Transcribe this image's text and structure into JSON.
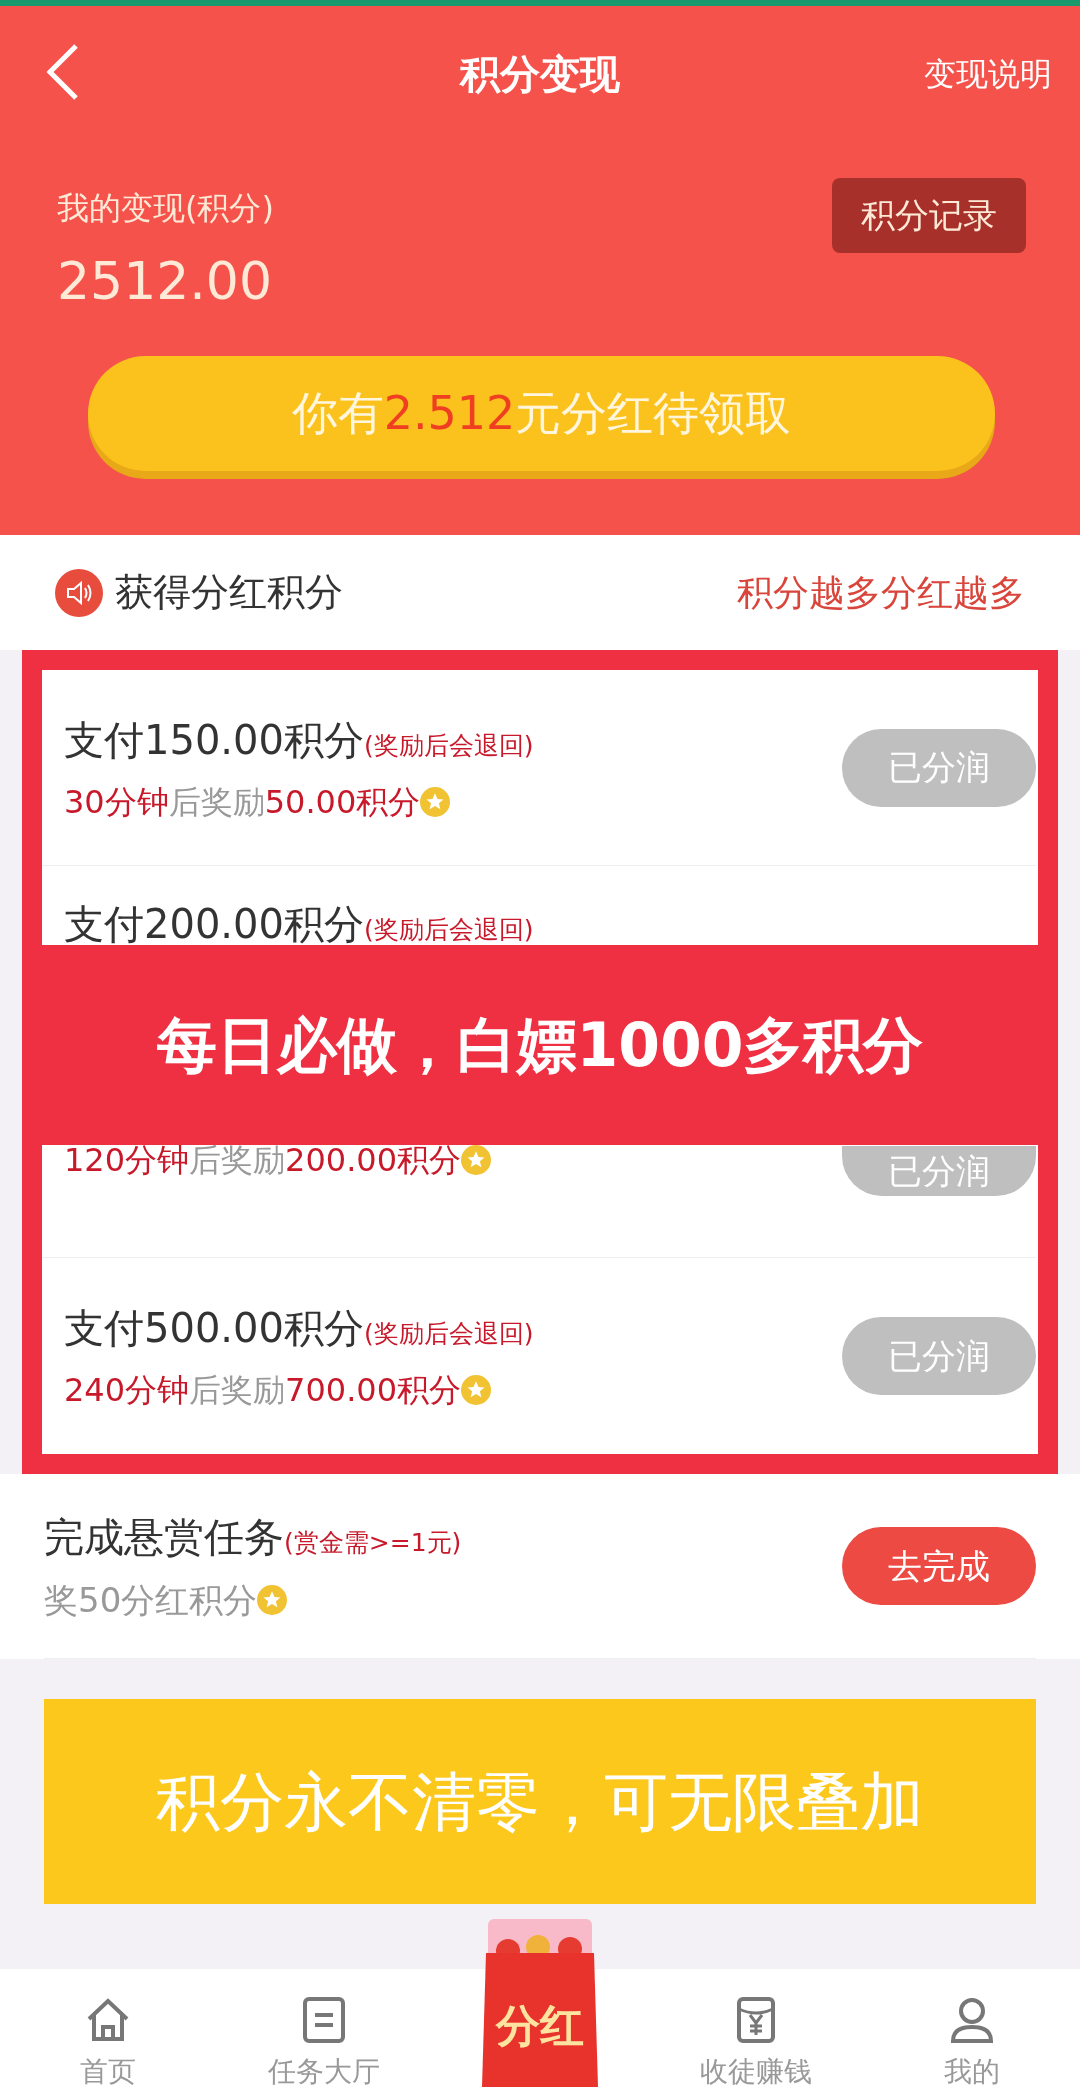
{
  "header": {
    "title": "积分变现",
    "action": "变现说明"
  },
  "balance": {
    "label": "我的变现(积分)",
    "value": "2512.00",
    "record_button": "积分记录"
  },
  "claim_button": "你有**2.512**元分红待领取",
  "section": {
    "title": "获得分红积分",
    "note": "积分越多分红越多"
  },
  "tasks": [
    {
      "title": "支付150.00积分",
      "hint": "(奖励后会退回)",
      "time": "30分钟",
      "middle": "后奖励",
      "reward": "50.00积分",
      "button": "已分润",
      "done": true
    },
    {
      "title": "支付200.00积分",
      "hint": "(奖励后会退回)"
    },
    {
      "time": "120分钟",
      "middle": "后奖励",
      "reward": "200.00积分",
      "button": "已分润",
      "done": true
    },
    {
      "title": "支付500.00积分",
      "hint": "(奖励后会退回)",
      "time": "240分钟",
      "middle": "后奖励",
      "reward": "700.00积分",
      "button": "已分润",
      "done": true
    }
  ],
  "bounty": {
    "title": "完成悬赏任务",
    "hint": "(赏金需>=1元)",
    "reward": "奖50分红积分",
    "button": "去完成",
    "done": false
  },
  "overlay_banner": "每日必做，白嫖1000多积分",
  "promo_banner": "积分永不清零，可无限叠加",
  "nav": [
    {
      "kind": "home",
      "label": "首页"
    },
    {
      "kind": "list",
      "label": "任务大厅"
    },
    {
      "kind": "packet",
      "label": "分红"
    },
    {
      "kind": "wallet",
      "label": "收徒赚钱"
    },
    {
      "kind": "user",
      "label": "我的"
    }
  ]
}
